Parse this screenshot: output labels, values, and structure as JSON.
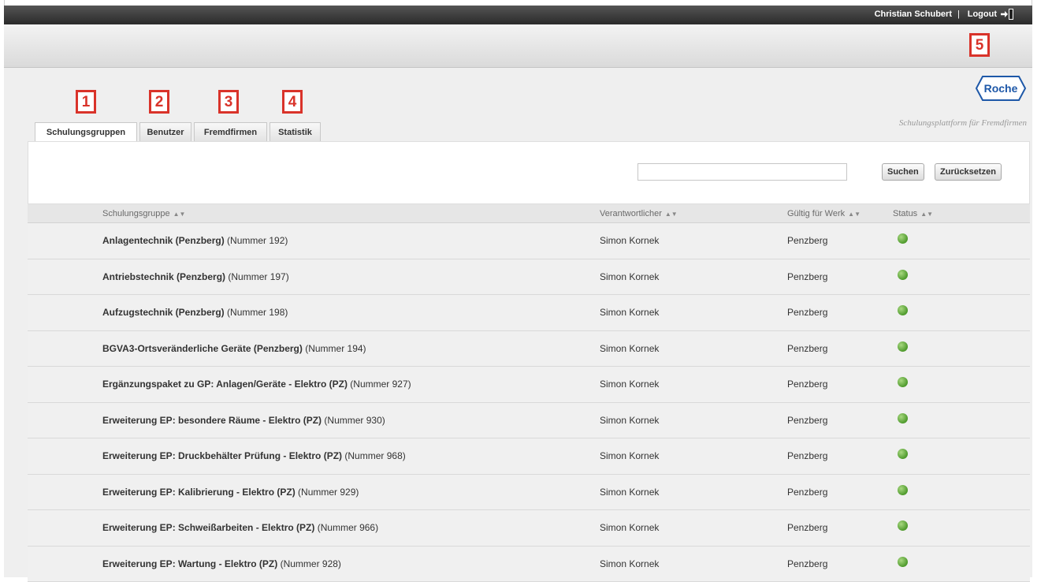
{
  "topbar": {
    "user_name": "Christian Schubert",
    "separator": "|",
    "logout_label": "Logout",
    "logout_icon": "logout-arrow-icon"
  },
  "markers": [
    "1",
    "2",
    "3",
    "4",
    "5"
  ],
  "brand": {
    "logo_text": "Roche",
    "tagline": "Schulungsplattform für Fremdfirmen",
    "color": "#1e58a8"
  },
  "tabs": [
    {
      "label": "Schulungsgruppen",
      "active": true
    },
    {
      "label": "Benutzer",
      "active": false
    },
    {
      "label": "Fremdfirmen",
      "active": false
    },
    {
      "label": "Statistik",
      "active": false
    }
  ],
  "search": {
    "value": "",
    "placeholder": "",
    "search_label": "Suchen",
    "reset_label": "Zurücksetzen"
  },
  "table": {
    "headers": [
      "Schulungsgruppe",
      "Verantwortlicher",
      "Gültig für Werk",
      "Status"
    ],
    "sort_icon": "sort-arrows-icon",
    "status_color": "#4e9a2c",
    "rows": [
      {
        "name": "Anlagentechnik (Penzberg)",
        "number": "(Nummer 192)",
        "responsible": "Simon Kornek",
        "plant": "Penzberg",
        "status": "active"
      },
      {
        "name": "Antriebstechnik (Penzberg)",
        "number": "(Nummer 197)",
        "responsible": "Simon Kornek",
        "plant": "Penzberg",
        "status": "active"
      },
      {
        "name": "Aufzugstechnik (Penzberg)",
        "number": "(Nummer 198)",
        "responsible": "Simon Kornek",
        "plant": "Penzberg",
        "status": "active"
      },
      {
        "name": "BGVA3-Ortsveränderliche Geräte (Penzberg)",
        "number": "(Nummer 194)",
        "responsible": "Simon Kornek",
        "plant": "Penzberg",
        "status": "active"
      },
      {
        "name": "Ergänzungspaket zu GP: Anlagen/Geräte - Elektro (PZ)",
        "number": "(Nummer 927)",
        "responsible": "Simon Kornek",
        "plant": "Penzberg",
        "status": "active"
      },
      {
        "name": "Erweiterung EP: besondere Räume - Elektro (PZ)",
        "number": "(Nummer 930)",
        "responsible": "Simon Kornek",
        "plant": "Penzberg",
        "status": "active"
      },
      {
        "name": "Erweiterung EP: Druckbehälter Prüfung - Elektro (PZ)",
        "number": "(Nummer 968)",
        "responsible": "Simon Kornek",
        "plant": "Penzberg",
        "status": "active"
      },
      {
        "name": "Erweiterung EP: Kalibrierung - Elektro (PZ)",
        "number": "(Nummer 929)",
        "responsible": "Simon Kornek",
        "plant": "Penzberg",
        "status": "active"
      },
      {
        "name": "Erweiterung EP: Schweißarbeiten - Elektro (PZ)",
        "number": "(Nummer 966)",
        "responsible": "Simon Kornek",
        "plant": "Penzberg",
        "status": "active"
      },
      {
        "name": "Erweiterung EP: Wartung - Elektro (PZ)",
        "number": "(Nummer 928)",
        "responsible": "Simon Kornek",
        "plant": "Penzberg",
        "status": "active"
      }
    ]
  }
}
